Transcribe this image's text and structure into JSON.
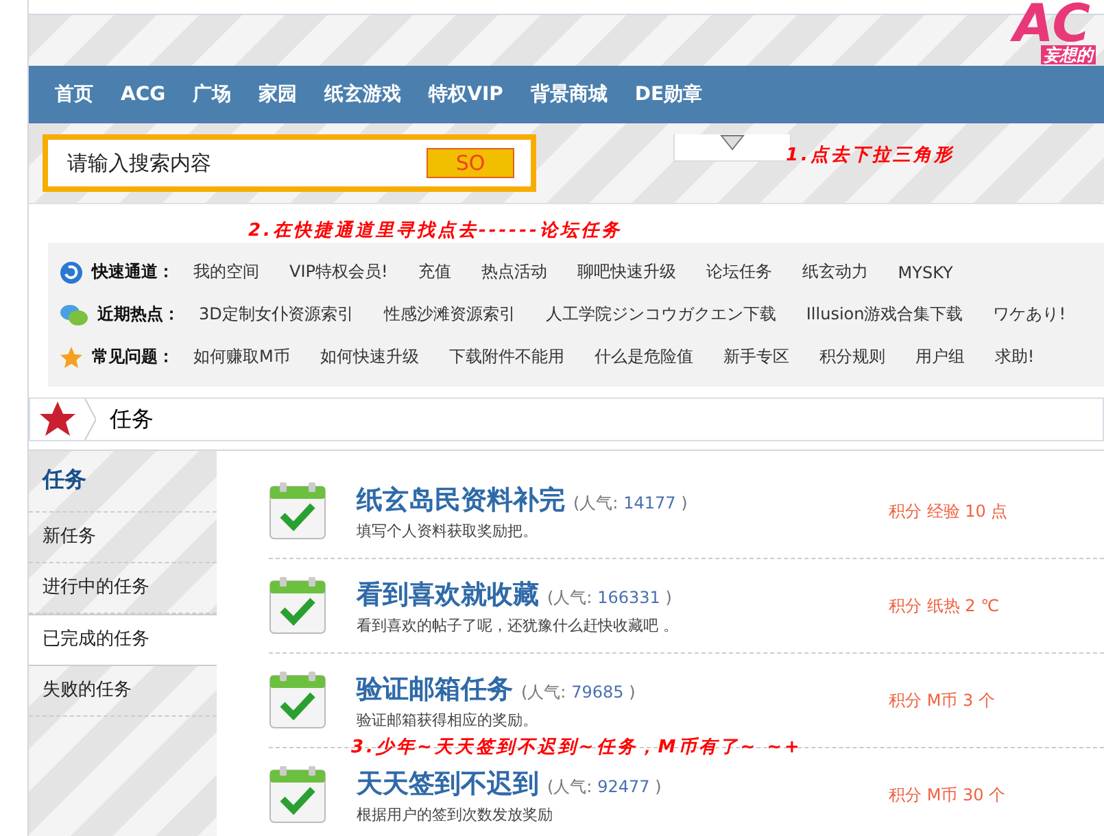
{
  "logo": {
    "mark": "AC",
    "slogan": "妄想的"
  },
  "nav": [
    "首页",
    "ACG",
    "广场",
    "家园",
    "纸玄游戏",
    "特权VIP",
    "背景商城",
    "DE勋章"
  ],
  "search": {
    "placeholder": "请输入搜索内容",
    "button": "SO"
  },
  "annotations": [
    "1.点去下拉三角形",
    "2.在快捷通道里寻找点去------论坛任务",
    "3.少年~天天签到不迟到~任务，M币有了~ ~+"
  ],
  "quick": [
    {
      "kind": "circle",
      "label": "快速通道：",
      "links": [
        "我的空间",
        "VIP特权会员!",
        "充值",
        "热点活动",
        "聊吧快速升级",
        "论坛任务",
        "纸玄动力",
        "MYSKY"
      ]
    },
    {
      "kind": "chat",
      "label": "近期热点：",
      "links": [
        "3D定制女仆资源索引",
        "性感沙滩资源索引",
        "人工学院ジンコウガクエン下载",
        "Illusion游戏合集下载",
        "ワケあり!"
      ]
    },
    {
      "kind": "star",
      "label": "常见问题：",
      "links": [
        "如何赚取M币",
        "如何快速升级",
        "下载附件不能用",
        "什么是危险值",
        "新手专区",
        "积分规则",
        "用户组",
        "求助!"
      ]
    }
  ],
  "breadcrumb": "任务",
  "sidebar": {
    "title": "任务",
    "items": [
      {
        "label": "新任务",
        "selected": false
      },
      {
        "label": "进行中的任务",
        "selected": false
      },
      {
        "label": "已完成的任务",
        "selected": true
      },
      {
        "label": "失败的任务",
        "selected": false
      }
    ]
  },
  "tasks": [
    {
      "title": "纸玄岛民资料补完",
      "pop_prefix": "(人气:",
      "pop_value": "14177",
      "pop_suffix": ")",
      "desc": "填写个人资料获取奖励把。",
      "reward": "积分 经验 10 点"
    },
    {
      "title": "看到喜欢就收藏",
      "pop_prefix": "(人气:",
      "pop_value": "166331",
      "pop_suffix": ")",
      "desc": "看到喜欢的帖子了呢，还犹豫什么赶快收藏吧 。",
      "reward": "积分 纸热 2 ℃"
    },
    {
      "title": "验证邮箱任务",
      "pop_prefix": "(人气:",
      "pop_value": "79685",
      "pop_suffix": ")",
      "desc": "验证邮箱获得相应的奖励。",
      "reward": "积分 M币 3 个"
    },
    {
      "title": "天天签到不迟到",
      "pop_prefix": "(人气:",
      "pop_value": "92477",
      "pop_suffix": ")",
      "desc": "根据用户的签到次数发放奖励",
      "reward": "积分 M币 30 个"
    }
  ]
}
